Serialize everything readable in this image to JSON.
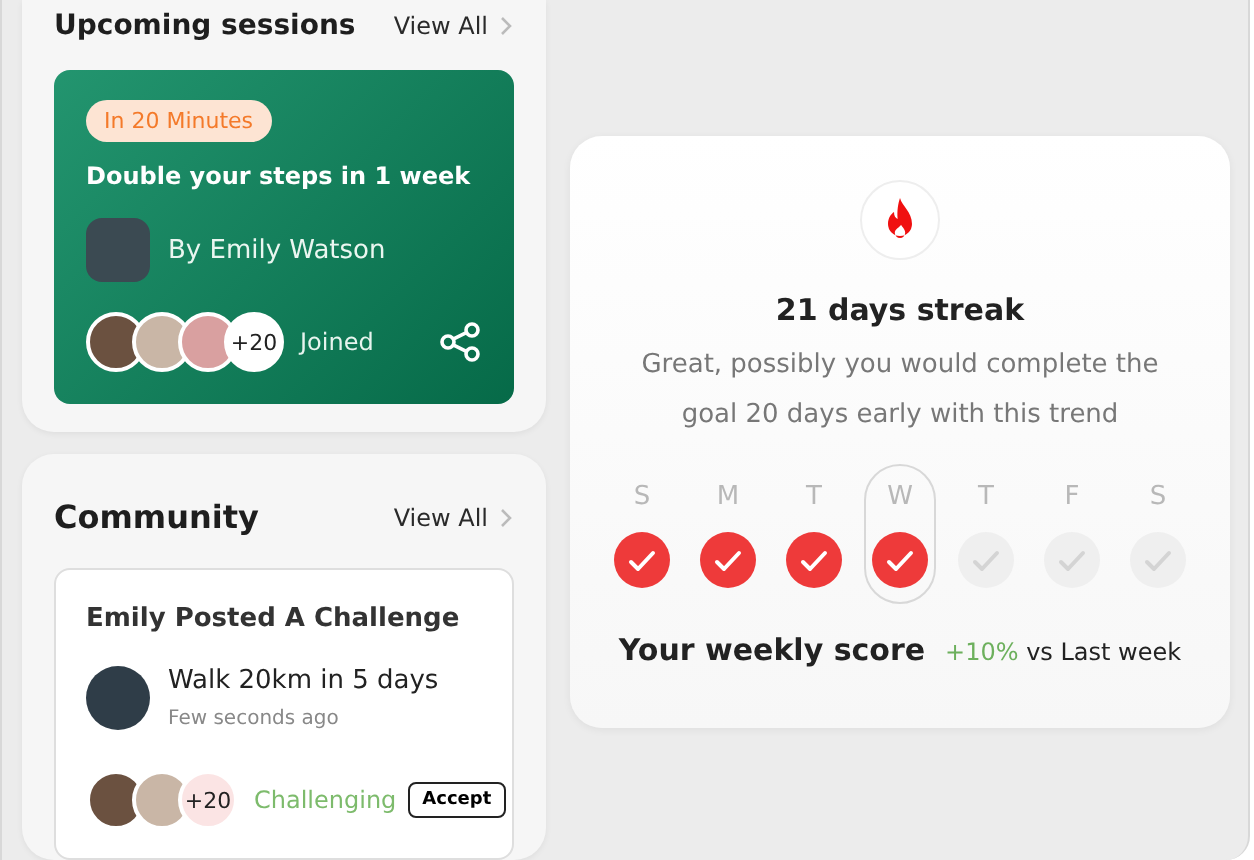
{
  "upcoming": {
    "title": "Upcoming sessions",
    "view_all": "View All",
    "session": {
      "badge": "In 20 Minutes",
      "title": "Double your steps in 1 week",
      "host": "By Emily Watson",
      "extra_count": "+20",
      "joined": "Joined"
    }
  },
  "community": {
    "title": "Community",
    "view_all": "View All",
    "post": {
      "heading": "Emily Posted A Challenge",
      "challenge": "Walk 20km in 5 days",
      "time": "Few seconds ago",
      "extra_count": "+20",
      "status": "Challenging",
      "action": "Accept"
    }
  },
  "streak": {
    "title": "21 days streak",
    "message": "Great, possibly you would complete the goal 20 days early with this trend",
    "days": [
      {
        "label": "S",
        "checked": true,
        "selected": false
      },
      {
        "label": "M",
        "checked": true,
        "selected": false
      },
      {
        "label": "T",
        "checked": true,
        "selected": false
      },
      {
        "label": "W",
        "checked": true,
        "selected": true
      },
      {
        "label": "T",
        "checked": false,
        "selected": false
      },
      {
        "label": "F",
        "checked": false,
        "selected": false
      },
      {
        "label": "S",
        "checked": false,
        "selected": false
      }
    ],
    "score_label": "Your weekly score",
    "change": "+10%",
    "comparison": "vs Last week"
  }
}
